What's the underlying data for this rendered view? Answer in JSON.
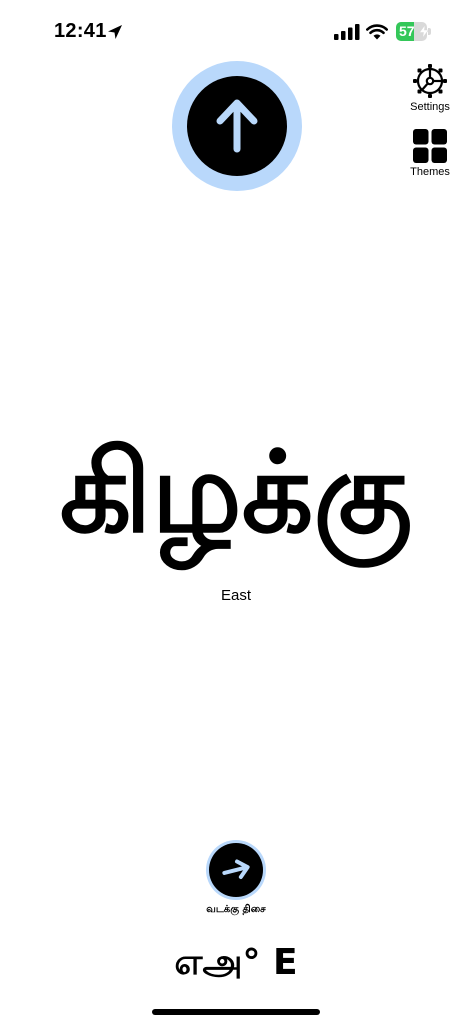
{
  "status_bar": {
    "time": "12:41",
    "battery_level": "57",
    "battery_percent": 57
  },
  "compass": {
    "main_arrow_direction": "up",
    "small_arrow_direction": "right",
    "accent_color": "#b9d8fb"
  },
  "sidebar": {
    "settings_label": "Settings",
    "themes_label": "Themes"
  },
  "main": {
    "direction_tamil": "கிழக்கு",
    "direction_english": "East",
    "small_caption": "வடக்கு திசை",
    "heading_text": "எஅ° E"
  },
  "colors": {
    "background": "#ffffff",
    "text": "#000000",
    "accent": "#b9d8fb",
    "battery": "#34c759"
  }
}
